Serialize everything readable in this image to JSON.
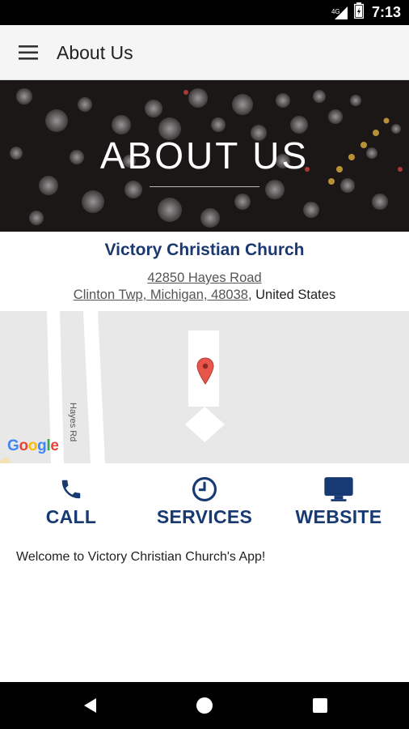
{
  "status_bar": {
    "time": "7:13",
    "network": "4G"
  },
  "toolbar": {
    "title": "About Us"
  },
  "hero": {
    "title": "ABOUT US"
  },
  "church": {
    "name": "Victory Christian Church",
    "address_line1": "42850 Hayes Road",
    "address_line2": "Clinton Twp, Michigan, 48038",
    "address_sep": ", ",
    "country": "United States"
  },
  "map": {
    "road_label": "Hayes Rd",
    "provider_logo": "Google"
  },
  "actions": [
    {
      "label": "CALL",
      "icon": "phone-icon"
    },
    {
      "label": "SERVICES",
      "icon": "clock-icon"
    },
    {
      "label": "WEBSITE",
      "icon": "monitor-icon"
    }
  ],
  "welcome_text": "Welcome to Victory Christian Church's App!",
  "colors": {
    "accent": "#1b3870",
    "toolbar_bg": "#f5f5f5",
    "map_bg": "#e8e8e8"
  }
}
